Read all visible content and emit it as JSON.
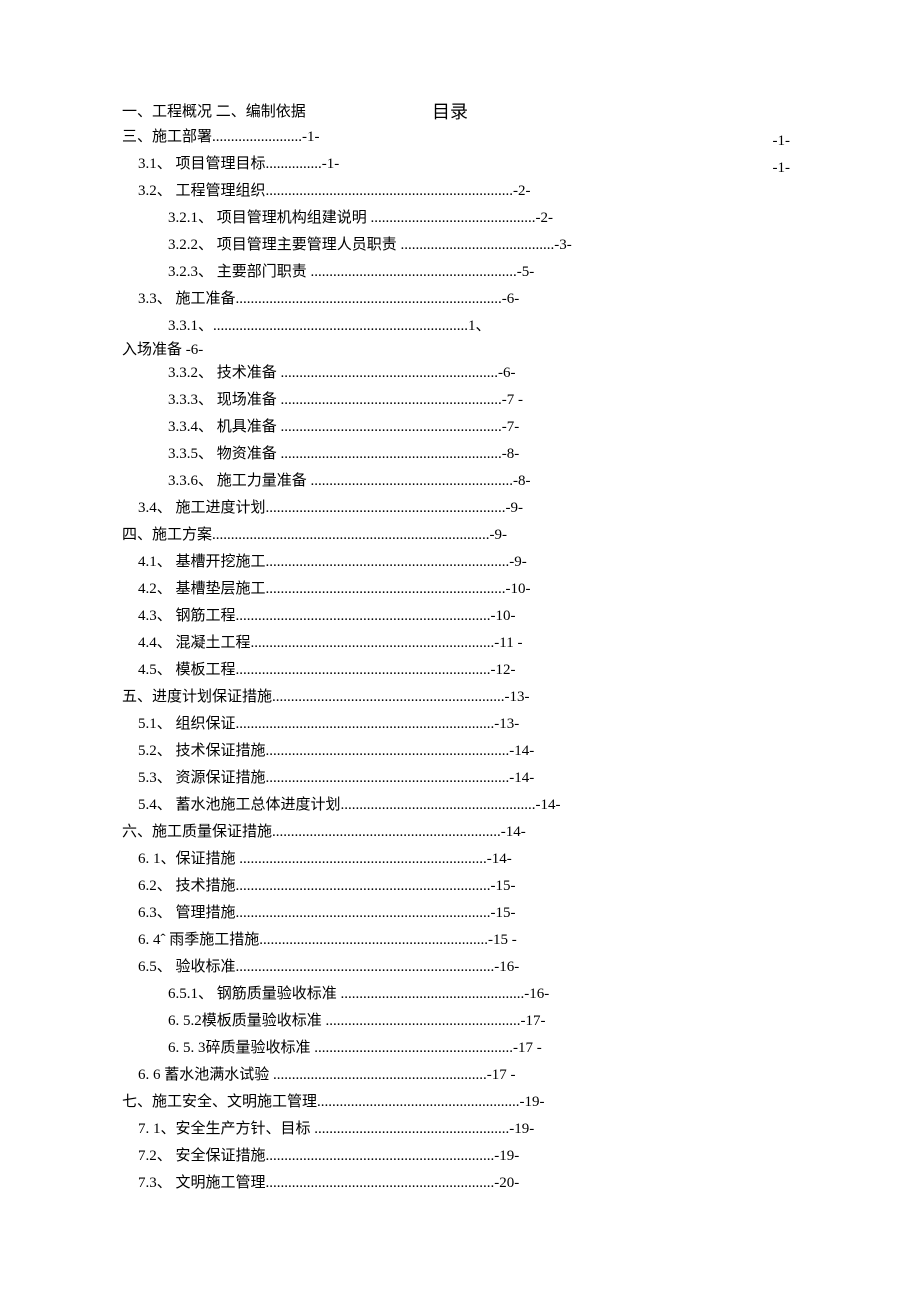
{
  "title_left": "一、工程概况 二、编制依据",
  "title_center": "目录",
  "float_page1": "-1-",
  "float_page2": "-1-",
  "lines": [
    {
      "indent": 0,
      "label": "三、施工部署",
      "dots": "........................",
      "page": "-1-"
    },
    {
      "indent": 1,
      "label": "3.1、 项目管理目标",
      "dots": "...............",
      "page": "-1-"
    },
    {
      "indent": 1,
      "label": "3.2、 工程管理组织",
      "dots": "..................................................................",
      "page": "-2-"
    },
    {
      "indent": 2,
      "label": "3.2.1、 项目管理机构组建说明 ",
      "dots": "............................................",
      "page": "-2-"
    },
    {
      "indent": 2,
      "label": "3.2.2、 项目管理主要管理人员职责 ",
      "dots": ".........................................",
      "page": "-3-"
    },
    {
      "indent": 2,
      "label": "3.2.3、 主要部门职责 ",
      "dots": ".......................................................",
      "page": "-5-"
    },
    {
      "indent": 1,
      "label": "3.3、 施工准备",
      "dots": ".......................................................................",
      "page": "-6-"
    },
    {
      "indent": 2,
      "label": "3.3.1、",
      "dots": "....................................................................",
      "page": "1、"
    },
    {
      "indent": 0,
      "label": "入场准备  -6-",
      "dots": "",
      "page": "",
      "hang": true
    },
    {
      "indent": 2,
      "label": "3.3.2、 技术准备 ",
      "dots": "..........................................................",
      "page": "-6-"
    },
    {
      "indent": 2,
      "label": "3.3.3、 现场准备 ",
      "dots": "...........................................................",
      "page": "-7 -"
    },
    {
      "indent": 2,
      "label": "3.3.4、 机具准备 ",
      "dots": "...........................................................",
      "page": "-7-"
    },
    {
      "indent": 2,
      "label": "3.3.5、 物资准备 ",
      "dots": "...........................................................",
      "page": "-8-"
    },
    {
      "indent": 2,
      "label": "3.3.6、 施工力量准备 ",
      "dots": "......................................................",
      "page": "-8-"
    },
    {
      "indent": 1,
      "label": "3.4、 施工进度计划",
      "dots": "................................................................",
      "page": "-9-"
    },
    {
      "indent": 0,
      "label": "四、施工方案",
      "dots": "..........................................................................",
      "page": "-9-"
    },
    {
      "indent": 1,
      "label": "4.1、 基槽开挖施工",
      "dots": ".................................................................",
      "page": "-9-"
    },
    {
      "indent": 1,
      "label": "4.2、 基槽垫层施工",
      "dots": "................................................................",
      "page": "-10-"
    },
    {
      "indent": 1,
      "label": "4.3、 钢筋工程",
      "dots": "....................................................................",
      "page": "-10-"
    },
    {
      "indent": 1,
      "label": "4.4、 混凝土工程",
      "dots": ".................................................................",
      "page": "-11 -"
    },
    {
      "indent": 1,
      "label": "4.5、 模板工程",
      "dots": "....................................................................",
      "page": "-12-"
    },
    {
      "indent": 0,
      "label": "五、进度计划保证措施",
      "dots": "..............................................................",
      "page": "-13-"
    },
    {
      "indent": 1,
      "label": "5.1、 组织保证",
      "dots": ".....................................................................",
      "page": "-13-"
    },
    {
      "indent": 1,
      "label": "5.2、 技术保证措施",
      "dots": ".................................................................",
      "page": "-14-"
    },
    {
      "indent": 1,
      "label": "5.3、 资源保证措施",
      "dots": ".................................................................",
      "page": "-14-"
    },
    {
      "indent": 1,
      "label": "5.4、 蓄水池施工总体进度计划",
      "dots": "....................................................",
      "page": "-14-"
    },
    {
      "indent": 0,
      "label": "六、施工质量保证措施",
      "dots": ".............................................................",
      "page": "-14-"
    },
    {
      "indent": 1,
      "label": "6. 1、保证措施 ",
      "dots": "..................................................................",
      "page": "-14-"
    },
    {
      "indent": 1,
      "label": "6.2、 技术措施",
      "dots": "....................................................................",
      "page": "-15-"
    },
    {
      "indent": 1,
      "label": "6.3、 管理措施",
      "dots": "....................................................................",
      "page": "-15-"
    },
    {
      "indent": 1,
      "label": "6. 4ˆ 雨季施工措施",
      "dots": ".............................................................",
      "page": "-15 -"
    },
    {
      "indent": 1,
      "label": "6.5、 验收标准",
      "dots": ".....................................................................",
      "page": "-16-"
    },
    {
      "indent": 2,
      "label": "6.5.1、 钢筋质量验收标准 ",
      "dots": ".................................................",
      "page": "-16-"
    },
    {
      "indent": 2,
      "label": "6. 5.2模板质量验收标准 ",
      "dots": "....................................................",
      "page": "-17-"
    },
    {
      "indent": 2,
      "label": "6. 5. 3碎质量验收标准 ",
      "dots": ".....................................................",
      "page": "-17 -"
    },
    {
      "indent": 1,
      "label": "6. 6 蓄水池满水试验 ",
      "dots": ".........................................................",
      "page": "-17 -"
    },
    {
      "indent": 0,
      "label": "七、施工安全、文明施工管理",
      "dots": "......................................................",
      "page": "-19-"
    },
    {
      "indent": 1,
      "label": "7. 1、安全生产方针、目标 ",
      "dots": "....................................................",
      "page": "-19-"
    },
    {
      "indent": 1,
      "label": "7.2、 安全保证措施",
      "dots": ".............................................................",
      "page": "-19-"
    },
    {
      "indent": 1,
      "label": "7.3、 文明施工管理",
      "dots": ".............................................................",
      "page": "-20-"
    }
  ]
}
